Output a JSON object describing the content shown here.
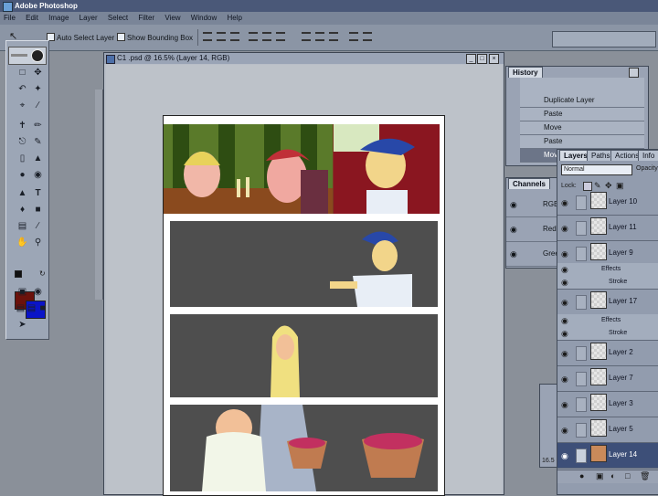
{
  "app": {
    "title": "Adobe Photoshop"
  },
  "menu": [
    "File",
    "Edit",
    "Image",
    "Layer",
    "Select",
    "Filter",
    "View",
    "Window",
    "Help"
  ],
  "options": {
    "auto_select_layer": "Auto Select Layer",
    "show_bounding_box": "Show Bounding Box"
  },
  "document": {
    "title": "C1 .psd @ 16.5% (Layer 14, RGB)",
    "zoom": "16.5"
  },
  "history": {
    "tab": "History",
    "items": [
      "Duplicate Layer",
      "Paste",
      "Move",
      "Paste",
      "Move"
    ]
  },
  "channels": {
    "tab": "Channels",
    "items": [
      "RGB",
      "Red",
      "Green"
    ]
  },
  "layers_palette": {
    "tabs": [
      "Layers",
      "Paths",
      "Actions",
      "Info"
    ],
    "blend_mode": "Normal",
    "opacity_label": "Opacity",
    "lock_label": "Lock:",
    "effects_label": "Effects",
    "stroke_label": "Stroke",
    "layers": [
      "Layer 10",
      "Layer 11",
      "Layer 9",
      "Layer 17",
      "Layer 2",
      "Layer 7",
      "Layer 3",
      "Layer 5",
      "Layer 14"
    ]
  },
  "colors": {
    "foreground": "#6b120c",
    "background": "#0a14c8",
    "panel_gray": "#4e4e4e"
  }
}
